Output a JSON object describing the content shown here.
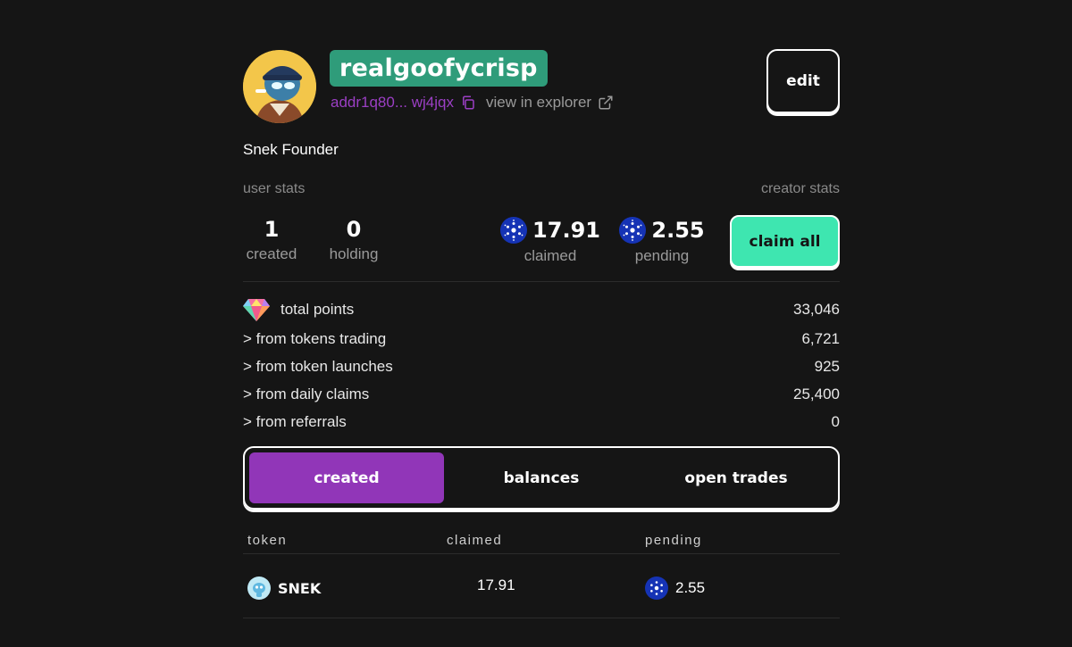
{
  "profile": {
    "username": "realgoofycrisp",
    "address": "addr1q80... wj4jqx",
    "explorer_label": "view in explorer",
    "bio": "Snek Founder",
    "edit_label": "edit"
  },
  "user_stats": {
    "label": "user stats",
    "created": {
      "value": "1",
      "label": "created"
    },
    "holding": {
      "value": "0",
      "label": "holding"
    }
  },
  "creator_stats": {
    "label": "creator stats",
    "claimed": {
      "value": "17.91",
      "label": "claimed"
    },
    "pending": {
      "value": "2.55",
      "label": "pending"
    },
    "claim_all_label": "claim all"
  },
  "points": {
    "total_label": "total points",
    "total_value": "33,046",
    "rows": [
      {
        "label": "> from tokens trading",
        "value": "6,721"
      },
      {
        "label": "> from token launches",
        "value": "925"
      },
      {
        "label": "> from daily claims",
        "value": "25,400"
      },
      {
        "label": "> from referrals",
        "value": "0"
      }
    ]
  },
  "tabs": [
    {
      "label": "created",
      "active": true
    },
    {
      "label": "balances",
      "active": false
    },
    {
      "label": "open trades",
      "active": false
    }
  ],
  "table": {
    "headers": [
      "token",
      "claimed",
      "pending"
    ],
    "rows": [
      {
        "token": "SNEK",
        "claimed": "17.91",
        "pending": "2.55"
      }
    ]
  },
  "colors": {
    "background": "#151515",
    "username_bg": "#2f9c7a",
    "address": "#9b3fc4",
    "claim_button": "#3ee6b0",
    "active_tab": "#9136b8",
    "ada_blue": "#1533b5"
  },
  "icons": [
    "copy-icon",
    "external-link-icon",
    "ada-icon",
    "gem-icon",
    "snek-icon"
  ]
}
